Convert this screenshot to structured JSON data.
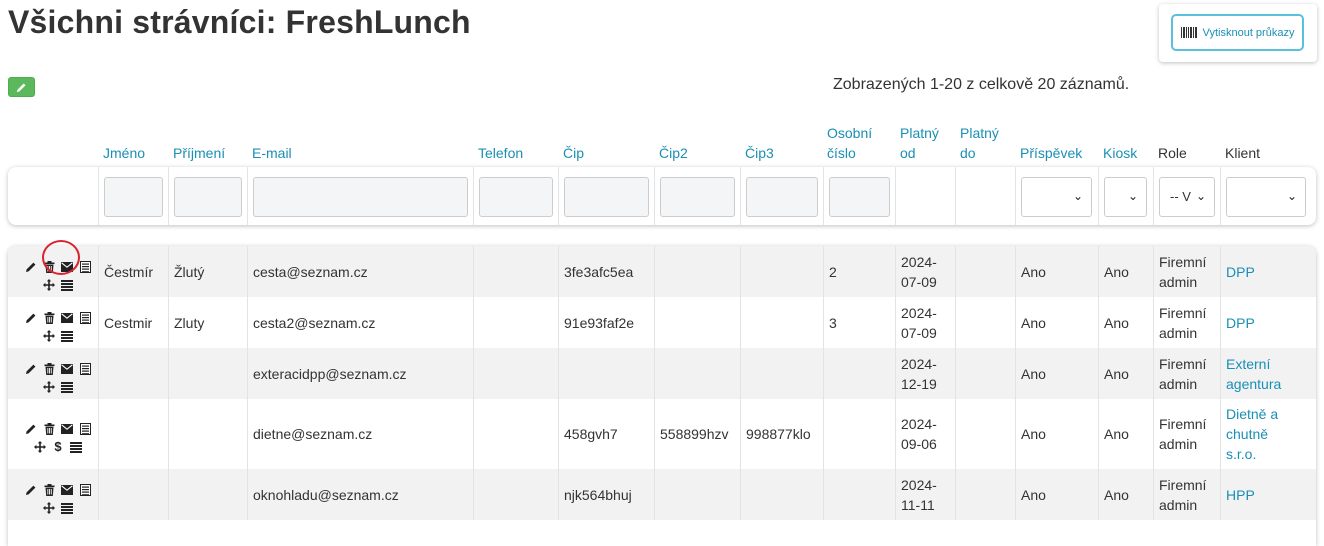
{
  "page": {
    "title": "Všichni strávníci: FreshLunch"
  },
  "print_button": {
    "label": "Vytisknout průkazy",
    "icon": "barcode-icon"
  },
  "edit_button": {
    "icon": "pencil-icon",
    "color": "#5cb85c"
  },
  "record_count": "Zobrazených 1-20 z celkově 20 záznamů.",
  "columns": {
    "jmeno": "Jméno",
    "prijmeni": "Příjmení",
    "email": "E-mail",
    "telefon": "Telefon",
    "cip": "Čip",
    "cip2": "Čip2",
    "cip3": "Čip3",
    "osobni_1": "Osobní",
    "osobni_2": "číslo",
    "platny_od_1": "Platný",
    "platny_od_2": "od",
    "platny_do_1": "Platný",
    "platny_do_2": "do",
    "prispevek": "Příspěvek",
    "kiosk": "Kiosk",
    "role": "Role",
    "klient": "Klient"
  },
  "filters": {
    "role_selected": "-- V"
  },
  "rows": [
    {
      "jmeno": "Čestmír",
      "prijmeni": "Žlutý",
      "email": "cesta@seznam.cz",
      "telefon": "",
      "cip": "3fe3afc5ea",
      "cip2": "",
      "cip3": "",
      "osobni": "2",
      "platny_od_1": "2024-",
      "platny_od_2": "07-09",
      "platny_do": "",
      "prispevek": "Ano",
      "kiosk": "Ano",
      "role_1": "Firemní",
      "role_2": "admin",
      "klient_lines": [
        "DPP"
      ],
      "has_dollar": false
    },
    {
      "jmeno": "Cestmir",
      "prijmeni": "Zluty",
      "email": "cesta2@seznam.cz",
      "telefon": "",
      "cip": "91e93faf2e",
      "cip2": "",
      "cip3": "",
      "osobni": "3",
      "platny_od_1": "2024-",
      "platny_od_2": "07-09",
      "platny_do": "",
      "prispevek": "Ano",
      "kiosk": "Ano",
      "role_1": "Firemní",
      "role_2": "admin",
      "klient_lines": [
        "DPP"
      ],
      "has_dollar": false
    },
    {
      "jmeno": "",
      "prijmeni": "",
      "email": "exteracidpp@seznam.cz",
      "telefon": "",
      "cip": "",
      "cip2": "",
      "cip3": "",
      "osobni": "",
      "platny_od_1": "2024-",
      "platny_od_2": "12-19",
      "platny_do": "",
      "prispevek": "Ano",
      "kiosk": "Ano",
      "role_1": "Firemní",
      "role_2": "admin",
      "klient_lines": [
        "Externí",
        "agentura"
      ],
      "has_dollar": false
    },
    {
      "jmeno": "",
      "prijmeni": "",
      "email": "dietne@seznam.cz",
      "telefon": "",
      "cip": "458gvh7",
      "cip2": "558899hzv",
      "cip3": "998877klo",
      "osobni": "",
      "platny_od_1": "2024-",
      "platny_od_2": "09-06",
      "platny_do": "",
      "prispevek": "Ano",
      "kiosk": "Ano",
      "role_1": "Firemní",
      "role_2": "admin",
      "klient_lines": [
        "Dietně a",
        "chutně",
        "s.r.o."
      ],
      "has_dollar": true
    },
    {
      "jmeno": "",
      "prijmeni": "",
      "email": "oknohladu@seznam.cz",
      "telefon": "",
      "cip": "njk564bhuj",
      "cip2": "",
      "cip3": "",
      "osobni": "",
      "platny_od_1": "2024-",
      "platny_od_2": "11-11",
      "platny_do": "",
      "prispevek": "Ano",
      "kiosk": "Ano",
      "role_1": "Firemní",
      "role_2": "admin",
      "klient_lines": [
        "HPP"
      ],
      "has_dollar": false
    }
  ],
  "row_action_icons": [
    "pencil-icon",
    "trash-icon",
    "envelope-icon",
    "list-icon",
    "move-icon",
    "dollar-icon",
    "menu-icon"
  ],
  "colors": {
    "link": "#1a8fb5",
    "accent_border": "#5bc0de",
    "highlight_circle": "#d9232e",
    "row_stripe": "#f2f2f2"
  }
}
